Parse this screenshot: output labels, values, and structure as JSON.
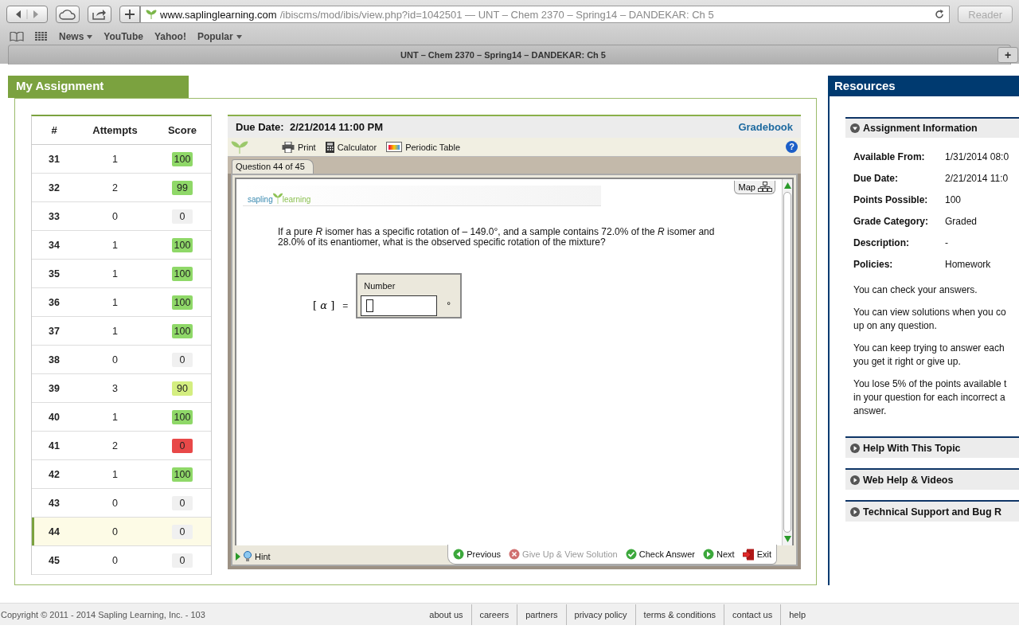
{
  "browser": {
    "address_host": "www.saplinglearning.com",
    "address_path": "/ibiscms/mod/ibis/view.php?id=1042501",
    "address_title": " — UNT – Chem 2370 – Spring14 – DANDEKAR: Ch 5",
    "reader": "Reader",
    "bookmarks": [
      {
        "label": "News",
        "menu": true
      },
      {
        "label": "YouTube",
        "menu": false
      },
      {
        "label": "Yahoo!",
        "menu": false
      },
      {
        "label": "Popular",
        "menu": true
      }
    ],
    "tab_title": "UNT – Chem 2370 – Spring14 – DANDEKAR: Ch 5",
    "new_tab": "+"
  },
  "assignment": {
    "title": "My Assignment",
    "columns": [
      "#",
      "Attempts",
      "Score"
    ],
    "rows": [
      {
        "number": "31",
        "attempts": "1",
        "score": "100",
        "color": "#8fd868",
        "selected": false
      },
      {
        "number": "32",
        "attempts": "2",
        "score": "99",
        "color": "#8fd868",
        "selected": false
      },
      {
        "number": "33",
        "attempts": "0",
        "score": "0",
        "color": "#f0f0f0",
        "selected": false
      },
      {
        "number": "34",
        "attempts": "1",
        "score": "100",
        "color": "#8fd868",
        "selected": false
      },
      {
        "number": "35",
        "attempts": "1",
        "score": "100",
        "color": "#8fd868",
        "selected": false
      },
      {
        "number": "36",
        "attempts": "1",
        "score": "100",
        "color": "#8fd868",
        "selected": false
      },
      {
        "number": "37",
        "attempts": "1",
        "score": "100",
        "color": "#8fd868",
        "selected": false
      },
      {
        "number": "38",
        "attempts": "0",
        "score": "0",
        "color": "#f0f0f0",
        "selected": false
      },
      {
        "number": "39",
        "attempts": "3",
        "score": "90",
        "color": "#d4ee80",
        "selected": false
      },
      {
        "number": "40",
        "attempts": "1",
        "score": "100",
        "color": "#8fd868",
        "selected": false
      },
      {
        "number": "41",
        "attempts": "2",
        "score": "0",
        "color": "#e84848",
        "selected": false
      },
      {
        "number": "42",
        "attempts": "1",
        "score": "100",
        "color": "#8fd868",
        "selected": false
      },
      {
        "number": "43",
        "attempts": "0",
        "score": "0",
        "color": "#f0f0f0",
        "selected": false
      },
      {
        "number": "44",
        "attempts": "0",
        "score": "0",
        "color": "#f0f0f0",
        "selected": true
      },
      {
        "number": "45",
        "attempts": "0",
        "score": "0",
        "color": "#f0f0f0",
        "selected": false
      }
    ]
  },
  "question": {
    "due_label": "Due Date:",
    "due_value": "2/21/2014 11:00 PM",
    "gradebook": "Gradebook",
    "tools": [
      {
        "kind": "print",
        "label": "Print"
      },
      {
        "kind": "calculator",
        "label": "Calculator"
      },
      {
        "kind": "periodic",
        "label": "Periodic Table"
      }
    ],
    "help": "?",
    "tab": "Question 44 of 45",
    "logo_left": "sapling",
    "logo_right": "learning",
    "map": "Map",
    "text": "If a pure *R* isomer has a specific rotation of – 149.0°, and a sample contains 72.0% of the *R* isomer and 28.0% of its enantiomer, what is the observed specific rotation of the mixture?",
    "answer": {
      "lhs_open": "[",
      "lhs_symbol": "α",
      "lhs_close": "]",
      "equals": "=",
      "field_label": "Number",
      "unit": "°"
    },
    "hint": "Hint",
    "actions": [
      {
        "kind": "previous",
        "label": "Previous",
        "disabled": false
      },
      {
        "kind": "giveup",
        "label": "Give Up & View Solution",
        "disabled": true
      },
      {
        "kind": "check",
        "label": "Check Answer",
        "disabled": false
      },
      {
        "kind": "next",
        "label": "Next",
        "disabled": false
      },
      {
        "kind": "exit",
        "label": "Exit",
        "disabled": false
      }
    ]
  },
  "resources": {
    "title": "Resources",
    "info": {
      "title": "Assignment Information",
      "expanded": true,
      "fields": [
        {
          "label": "Available From:",
          "value": "1/31/2014 08:0"
        },
        {
          "label": "Due Date:",
          "value": "2/21/2014 11:0"
        },
        {
          "label": "Points Possible:",
          "value": "100"
        },
        {
          "label": "Grade Category:",
          "value": "Graded"
        },
        {
          "label": "Description:",
          "value": "-"
        },
        {
          "label": "Policies:",
          "value": "Homework"
        }
      ],
      "policies": [
        [
          "You can check your answers."
        ],
        [
          "You can view solutions when you co",
          "up on any question."
        ],
        [
          "You can keep trying to answer each",
          "you get it right or give up."
        ],
        [
          "You lose 5% of the points available t",
          "in your question for each incorrect a",
          "answer."
        ]
      ]
    },
    "sections": [
      {
        "title": "Help With This Topic",
        "expanded": false
      },
      {
        "title": "Web Help & Videos",
        "expanded": false
      },
      {
        "title": "Technical Support and Bug R",
        "expanded": false
      }
    ]
  },
  "footer": {
    "copyright": "Copyright © 2011 - 2014 Sapling Learning, Inc. - 103",
    "links": [
      "about us",
      "careers",
      "partners",
      "privacy policy",
      "terms & conditions",
      "contact us",
      "help"
    ]
  }
}
